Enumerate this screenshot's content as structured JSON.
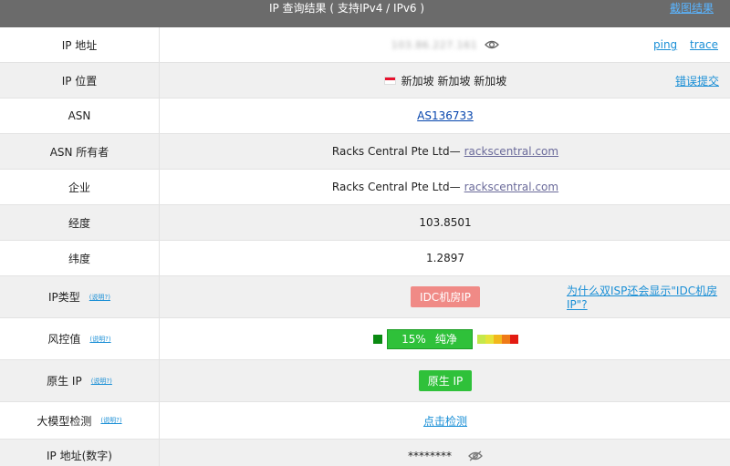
{
  "header": {
    "title": "IP 查询结果 ( 支持IPv4 / IPv6 )",
    "screenshot_link": "截图结果"
  },
  "rows": {
    "ip": {
      "label": "IP 地址",
      "value": "103.86.227.161",
      "ping": "ping",
      "trace": "trace"
    },
    "location": {
      "label": "IP 位置",
      "value": "新加坡 新加坡 新加坡",
      "report": "错误提交"
    },
    "asn": {
      "label": "ASN",
      "value": "AS136733"
    },
    "asn_owner": {
      "label": "ASN 所有者",
      "company": "Racks Central Pte Ltd—",
      "domain": "rackscentral.com"
    },
    "enterprise": {
      "label": "企业",
      "company": "Racks Central Pte Ltd—",
      "domain": "rackscentral.com"
    },
    "longitude": {
      "label": "经度",
      "value": "103.8501"
    },
    "latitude": {
      "label": "纬度",
      "value": "1.2897"
    },
    "ip_type": {
      "label": "IP类型",
      "help": "(说明?)",
      "badge": "IDC机房IP",
      "question": "为什么双ISP还会显示\"IDC机房IP\"?"
    },
    "risk": {
      "label": "风控值",
      "help": "(说明?)",
      "percent": "15%",
      "status": "纯净",
      "scale_colors": [
        "#c6e84b",
        "#e6e33a",
        "#f2b81c",
        "#ef7a17",
        "#e31b12"
      ]
    },
    "native": {
      "label": "原生 IP",
      "help": "(说明?)",
      "badge": "原生 IP"
    },
    "llm": {
      "label": "大模型检测",
      "help": "(说明?)",
      "action": "点击检测"
    },
    "ip_numeric": {
      "label": "IP 地址(数字)",
      "value": "********"
    }
  },
  "icons": {
    "eye": "eye-icon",
    "eye_off": "eye-off-icon",
    "flag": "singapore-flag-icon"
  }
}
